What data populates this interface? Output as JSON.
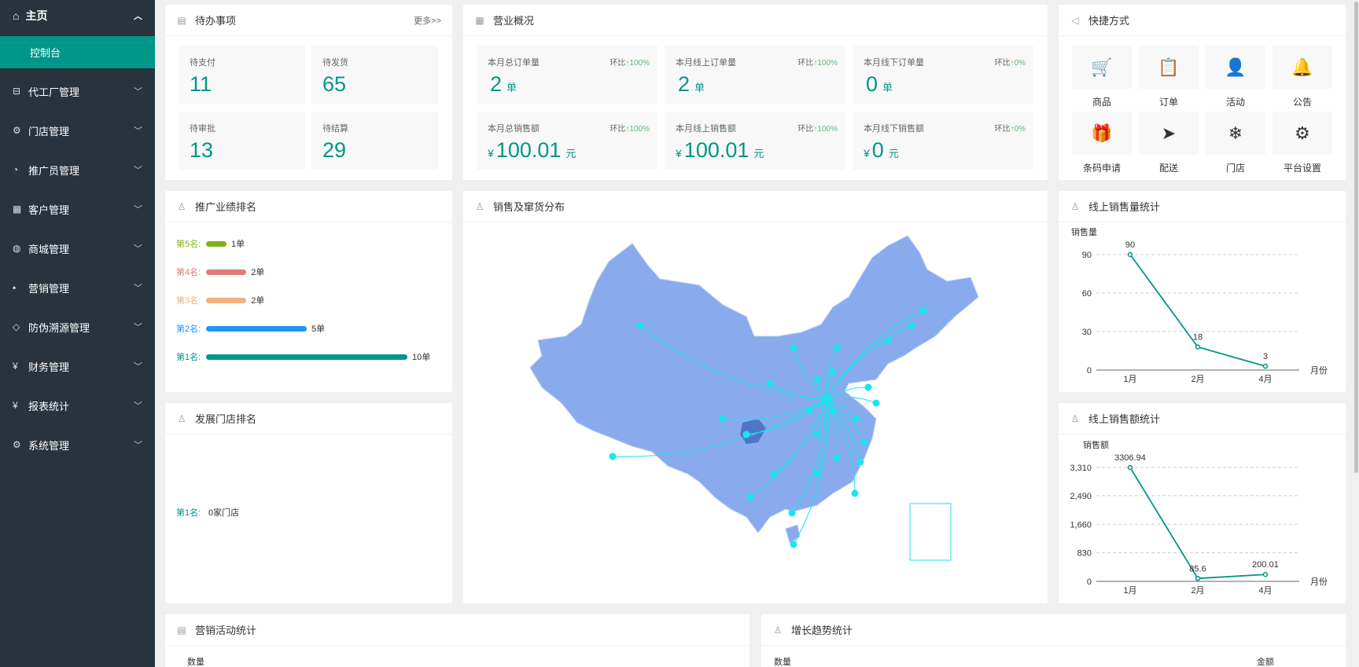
{
  "sidebar": {
    "home": "主页",
    "console": "控制台",
    "items": [
      {
        "label": "代工厂管理",
        "icon": "factory-icon",
        "glyph": "⊟"
      },
      {
        "label": "门店管理",
        "icon": "store-icon",
        "glyph": "⚙"
      },
      {
        "label": "推广员管理",
        "icon": "gauge-icon",
        "glyph": "◔"
      },
      {
        "label": "客户管理",
        "icon": "calendar-icon",
        "glyph": "▦"
      },
      {
        "label": "商城管理",
        "icon": "globe-icon",
        "glyph": "◍"
      },
      {
        "label": "营销管理",
        "icon": "chat-icon",
        "glyph": "▪"
      },
      {
        "label": "防伪溯源管理",
        "icon": "shield-icon",
        "glyph": "◇"
      },
      {
        "label": "财务管理",
        "icon": "yen-icon",
        "glyph": "¥"
      },
      {
        "label": "报表统计",
        "icon": "yen-circle-icon",
        "glyph": "¥"
      },
      {
        "label": "系统管理",
        "icon": "gear-icon",
        "glyph": "⚙"
      }
    ]
  },
  "todo": {
    "title": "待办事项",
    "more": "更多>>",
    "tiles": [
      {
        "label": "待支付",
        "value": "11"
      },
      {
        "label": "待发货",
        "value": "65"
      },
      {
        "label": "待审批",
        "value": "13"
      },
      {
        "label": "待结算",
        "value": "29"
      }
    ]
  },
  "business": {
    "title": "营业概况",
    "tiles": [
      {
        "label": "本月总订单量",
        "ratio_prefix": "环比",
        "ratio": "↑100%",
        "value": "2",
        "unit": "单",
        "currency": ""
      },
      {
        "label": "本月线上订单量",
        "ratio_prefix": "环比",
        "ratio": "↑100%",
        "value": "2",
        "unit": "单",
        "currency": ""
      },
      {
        "label": "本月线下订单量",
        "ratio_prefix": "环比",
        "ratio": "↑0%",
        "value": "0",
        "unit": "单",
        "currency": ""
      },
      {
        "label": "本月总销售额",
        "ratio_prefix": "环比",
        "ratio": "↑100%",
        "value": "100.01",
        "unit": "元",
        "currency": "¥"
      },
      {
        "label": "本月线上销售额",
        "ratio_prefix": "环比",
        "ratio": "↑100%",
        "value": "100.01",
        "unit": "元",
        "currency": "¥"
      },
      {
        "label": "本月线下销售额",
        "ratio_prefix": "环比",
        "ratio": "↑0%",
        "value": "0",
        "unit": "元",
        "currency": "¥"
      }
    ]
  },
  "quick": {
    "title": "快捷方式",
    "items": [
      {
        "label": "商品",
        "icon": "cart-icon",
        "glyph": "🛒"
      },
      {
        "label": "订单",
        "icon": "clipboard-icon",
        "glyph": "📋"
      },
      {
        "label": "活动",
        "icon": "user-icon",
        "glyph": "👤"
      },
      {
        "label": "公告",
        "icon": "bell-icon",
        "glyph": "🔔"
      },
      {
        "label": "条码申请",
        "icon": "gift-icon",
        "glyph": "🎁"
      },
      {
        "label": "配送",
        "icon": "send-icon",
        "glyph": "➤"
      },
      {
        "label": "门店",
        "icon": "snowflake-icon",
        "glyph": "❄"
      },
      {
        "label": "平台设置",
        "icon": "gear-icon",
        "glyph": "⚙"
      }
    ]
  },
  "promoter_rank": {
    "title": "推广业绩排名",
    "items": [
      {
        "label": "第5名:",
        "value": "1单",
        "count": 1,
        "color": "#7fb410"
      },
      {
        "label": "第4名:",
        "value": "2单",
        "count": 2,
        "color": "#e07a7a"
      },
      {
        "label": "第3名:",
        "value": "2单",
        "count": 2,
        "color": "#f4b07a"
      },
      {
        "label": "第2名:",
        "value": "5单",
        "count": 5,
        "color": "#2196f3"
      },
      {
        "label": "第1名:",
        "value": "10单",
        "count": 10,
        "color": "#009688"
      }
    ]
  },
  "store_rank": {
    "title": "发展门店排名",
    "items": [
      {
        "label": "第1名:",
        "value": "0家门店"
      }
    ]
  },
  "map": {
    "title": "销售及窜货分布"
  },
  "sales_volume": {
    "title": "线上销售量统计",
    "chart_data": {
      "type": "line",
      "ylabel": "销售量",
      "xlabel": "月份",
      "categories": [
        "1月",
        "2月",
        "4月"
      ],
      "values": [
        90,
        18,
        3
      ],
      "yticks": [
        0,
        30,
        60,
        90
      ],
      "ylim": [
        0,
        90
      ]
    }
  },
  "sales_amount": {
    "title": "线上销售额统计",
    "chart_data": {
      "type": "line",
      "ylabel": "销售额",
      "xlabel": "月份",
      "categories": [
        "1月",
        "2月",
        "4月"
      ],
      "values": [
        3306.94,
        85.6,
        200.01
      ],
      "yticks": [
        0,
        830,
        1660,
        2490,
        3310
      ],
      "ytick_labels": [
        "0",
        "830",
        "1,660",
        "2,490",
        "3,310"
      ],
      "ylim": [
        0,
        3310
      ]
    }
  },
  "marketing": {
    "title": "营销活动统计",
    "ylabel": "数量"
  },
  "growth": {
    "title": "增长趋势统计",
    "ylabel_left": "数量",
    "ylabel_right": "金额"
  },
  "colors": {
    "accent": "#009688",
    "sidebar": "#28333e",
    "map_fill": "#8aaaee",
    "flow": "#19e6f0"
  }
}
